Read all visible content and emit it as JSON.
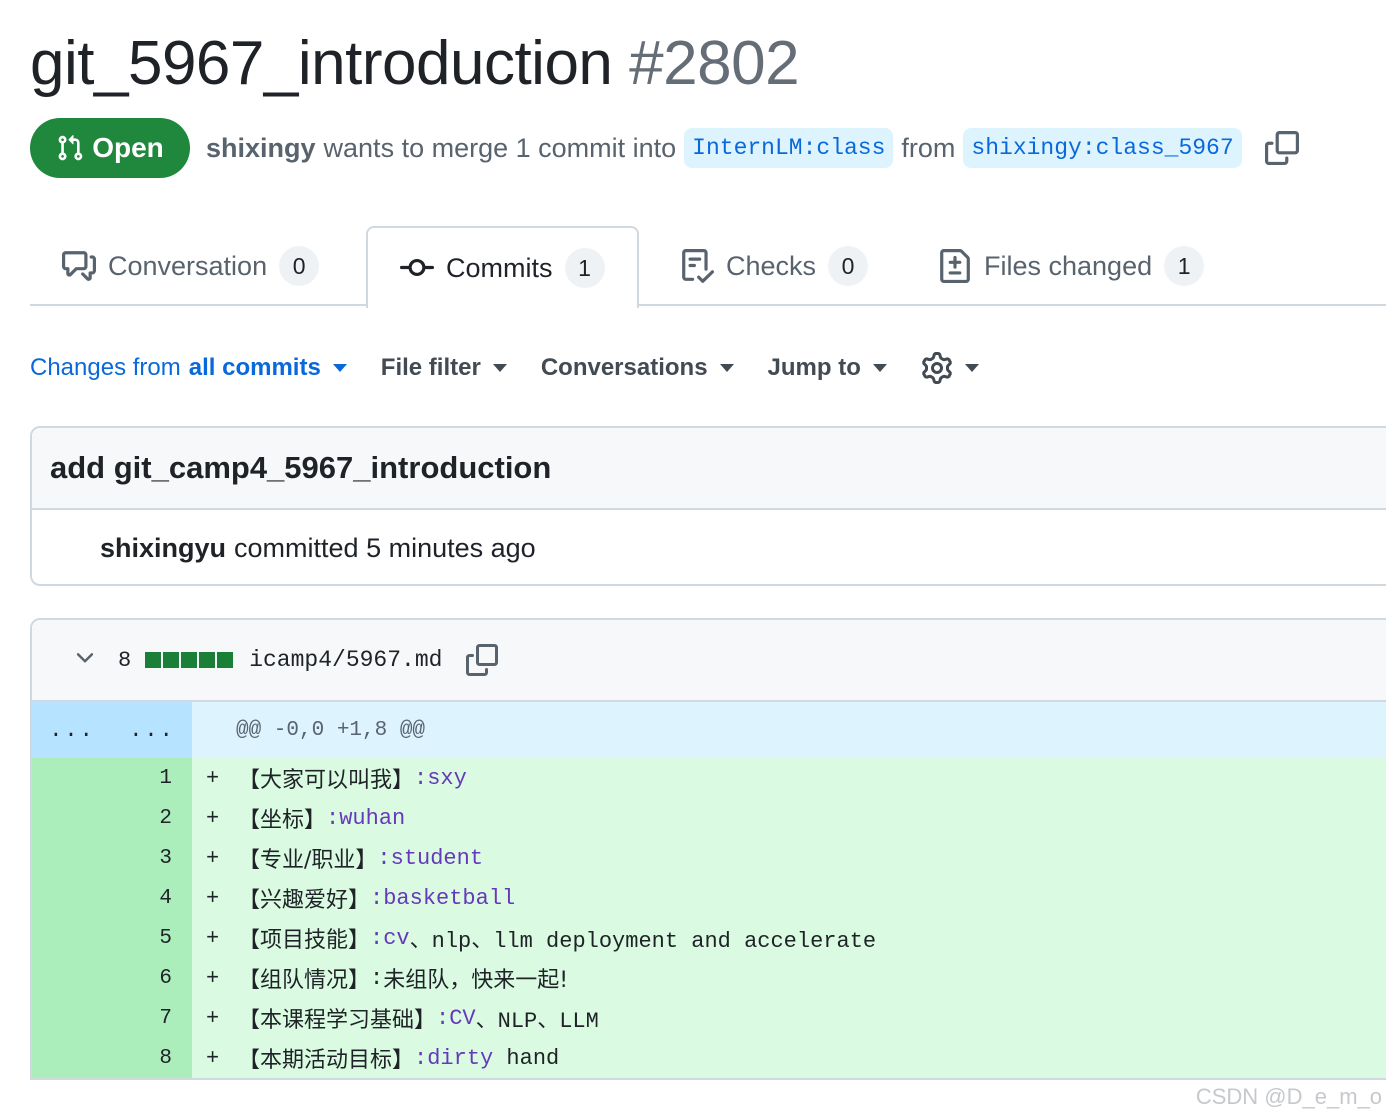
{
  "pr": {
    "title": "git_5967_introduction",
    "number": "#2802",
    "state": "Open",
    "author": "shixingy",
    "merge_text": "wants to merge 1 commit into",
    "base_branch": "InternLM:class",
    "from_text": "from",
    "head_branch": "shixingy:class_5967"
  },
  "tabs": [
    {
      "label": "Conversation",
      "count": "0",
      "icon": "comment-discussion-icon"
    },
    {
      "label": "Commits",
      "count": "1",
      "icon": "git-commit-icon"
    },
    {
      "label": "Checks",
      "count": "0",
      "icon": "checklist-icon"
    },
    {
      "label": "Files changed",
      "count": "1",
      "icon": "file-diff-icon"
    }
  ],
  "toolbar": {
    "changes_prefix": "Changes from",
    "changes_value": "all commits",
    "file_filter": "File filter",
    "conversations": "Conversations",
    "jump_to": "Jump to"
  },
  "commit": {
    "message": "add git_camp4_5967_introduction",
    "author": "shixingyu",
    "time_text": "committed 5 minutes ago"
  },
  "diff": {
    "additions": "8",
    "filename": "icamp4/5967.md",
    "hunk_ellipsis_old": "...",
    "hunk_ellipsis_new": "...",
    "hunk_header": "@@ -0,0 +1,8 @@",
    "lines": [
      {
        "num": "1",
        "sign": "+",
        "key": "【大家可以叫我】",
        "colon": ":",
        "value": "sxy",
        "rest": ""
      },
      {
        "num": "2",
        "sign": "+",
        "key": "【坐标】",
        "colon": ":",
        "value": "wuhan",
        "rest": ""
      },
      {
        "num": "3",
        "sign": "+",
        "key": "【专业/职业】",
        "colon": ":",
        "value": "student",
        "rest": ""
      },
      {
        "num": "4",
        "sign": "+",
        "key": "【兴趣爱好】",
        "colon": ":",
        "value": "basketball",
        "rest": ""
      },
      {
        "num": "5",
        "sign": "+",
        "key": "【项目技能】",
        "colon": ":",
        "value": "cv",
        "rest": "、nlp、llm deployment and accelerate"
      },
      {
        "num": "6",
        "sign": "+",
        "key": "【组队情况】",
        "colon": ":",
        "value": "",
        "rest": "未组队，快来一起!"
      },
      {
        "num": "7",
        "sign": "+",
        "key": "【本课程学习基础】",
        "colon": ":",
        "value": "CV",
        "rest": "、NLP、LLM"
      },
      {
        "num": "8",
        "sign": "+",
        "key": "【本期活动目标】",
        "colon": ":",
        "value": "dirty",
        "rest": " hand"
      }
    ]
  },
  "watermark": "CSDN @D_e_m_o",
  "colors": {
    "open_green": "#1f883d",
    "link_blue": "#0969da",
    "branch_bg": "#ddf4ff",
    "added_bg": "#dafbe1",
    "added_ln_bg": "#aceebb",
    "hunk_bg": "#ddf4ff",
    "value_purple": "#6639ba"
  }
}
